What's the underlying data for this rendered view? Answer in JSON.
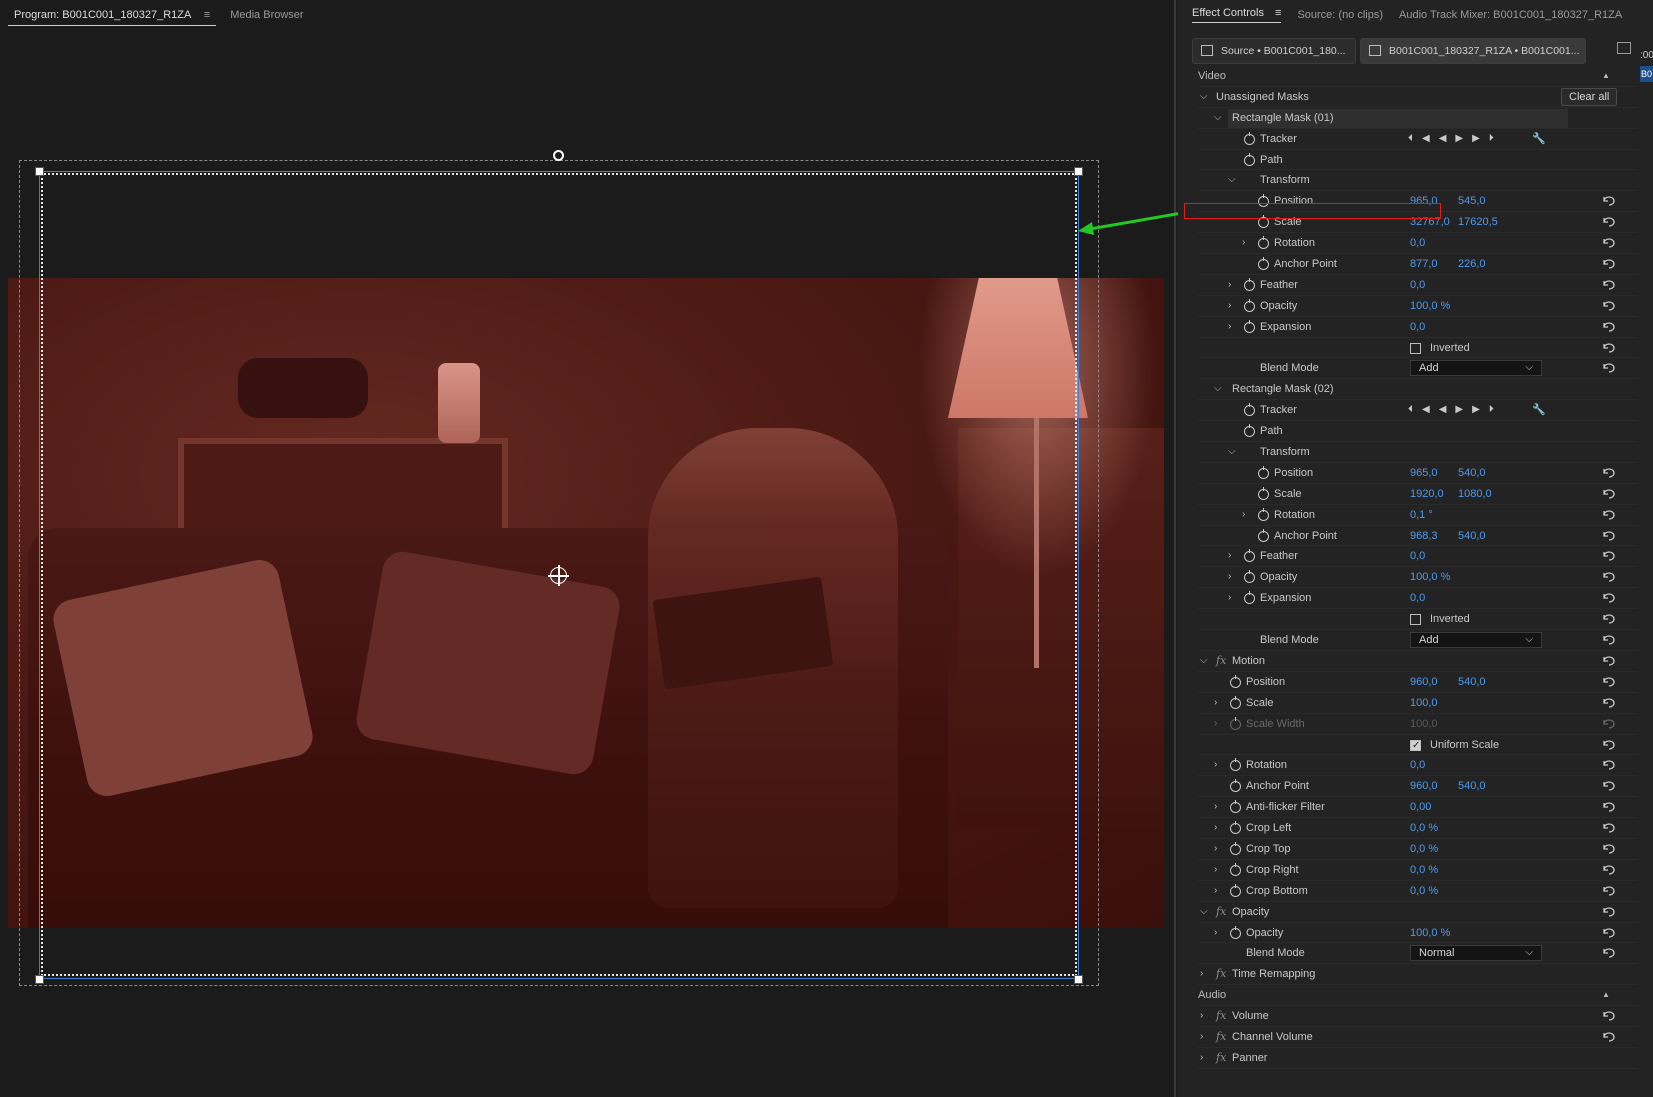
{
  "program": {
    "tab_label": "Program: B001C001_180327_R1ZA",
    "menu_glyph": "≡",
    "media_browser": "Media Browser"
  },
  "effect_controls": {
    "tabs": {
      "effect_controls": "Effect Controls",
      "menu_glyph": "≡",
      "source": "Source: (no clips)",
      "audio_mixer": "Audio Track Mixer: B001C001_180327_R1ZA"
    },
    "clip_source": "Source • B001C001_180...",
    "clip_sequence": "B001C001_180327_R1ZA • B001C001...",
    "edge_tab": "B0",
    "edge_tab2": ":00",
    "video_header": "Video",
    "audio_header": "Audio",
    "unassigned_masks": "Unassigned Masks",
    "clear_all": "Clear all",
    "mask1": {
      "name": "Rectangle Mask (01)",
      "tracker": "Tracker",
      "path": "Path",
      "transform": "Transform",
      "position": {
        "label": "Position",
        "v1": "965,0",
        "v2": "545,0"
      },
      "scale": {
        "label": "Scale",
        "v1": "32767,0",
        "v2": "17620,5"
      },
      "rotation": {
        "label": "Rotation",
        "v1": "0,0"
      },
      "anchor": {
        "label": "Anchor Point",
        "v1": "877,0",
        "v2": "226,0"
      },
      "feather": {
        "label": "Feather",
        "v1": "0,0"
      },
      "opacity": {
        "label": "Opacity",
        "v1": "100,0 %"
      },
      "expansion": {
        "label": "Expansion",
        "v1": "0,0"
      },
      "inverted": "Inverted",
      "blend_label": "Blend Mode",
      "blend_value": "Add"
    },
    "mask2": {
      "name": "Rectangle Mask (02)",
      "tracker": "Tracker",
      "path": "Path",
      "transform": "Transform",
      "position": {
        "label": "Position",
        "v1": "965,0",
        "v2": "540,0"
      },
      "scale": {
        "label": "Scale",
        "v1": "1920,0",
        "v2": "1080,0"
      },
      "rotation": {
        "label": "Rotation",
        "v1": "0,1 °"
      },
      "anchor": {
        "label": "Anchor Point",
        "v1": "968,3",
        "v2": "540,0"
      },
      "feather": {
        "label": "Feather",
        "v1": "0,0"
      },
      "opacity": {
        "label": "Opacity",
        "v1": "100,0 %"
      },
      "expansion": {
        "label": "Expansion",
        "v1": "0,0"
      },
      "inverted": "Inverted",
      "blend_label": "Blend Mode",
      "blend_value": "Add"
    },
    "motion": {
      "name": "Motion",
      "position": {
        "label": "Position",
        "v1": "960,0",
        "v2": "540,0"
      },
      "scale": {
        "label": "Scale",
        "v1": "100,0"
      },
      "scale_width": {
        "label": "Scale Width",
        "v1": "100,0"
      },
      "uniform_scale": "Uniform Scale",
      "rotation": {
        "label": "Rotation",
        "v1": "0,0"
      },
      "anchor": {
        "label": "Anchor Point",
        "v1": "960,0",
        "v2": "540,0"
      },
      "antiflicker": {
        "label": "Anti-flicker Filter",
        "v1": "0,00"
      },
      "crop_left": {
        "label": "Crop Left",
        "v1": "0,0 %"
      },
      "crop_top": {
        "label": "Crop Top",
        "v1": "0,0 %"
      },
      "crop_right": {
        "label": "Crop Right",
        "v1": "0,0 %"
      },
      "crop_bottom": {
        "label": "Crop Bottom",
        "v1": "0,0 %"
      }
    },
    "opacity_fx": {
      "name": "Opacity",
      "opacity": {
        "label": "Opacity",
        "v1": "100,0 %"
      },
      "blend_label": "Blend Mode",
      "blend_value": "Normal"
    },
    "time_remapping": "Time Remapping",
    "volume": "Volume",
    "channel_volume": "Channel Volume",
    "panner": "Panner",
    "icons": {
      "fx": "fx",
      "chev_down": "⌵",
      "chev_right": "›",
      "sort_up": "▲",
      "dd_arrow": "⌵",
      "transport": "⏴◀◀▶▶⏵",
      "wrench": "🔧"
    }
  },
  "colors": {
    "accent_blue": "#4c9bf0",
    "annotation_red": "#e11a1a",
    "annotation_green": "#22c922",
    "mask_blue": "#3d7fd6"
  }
}
